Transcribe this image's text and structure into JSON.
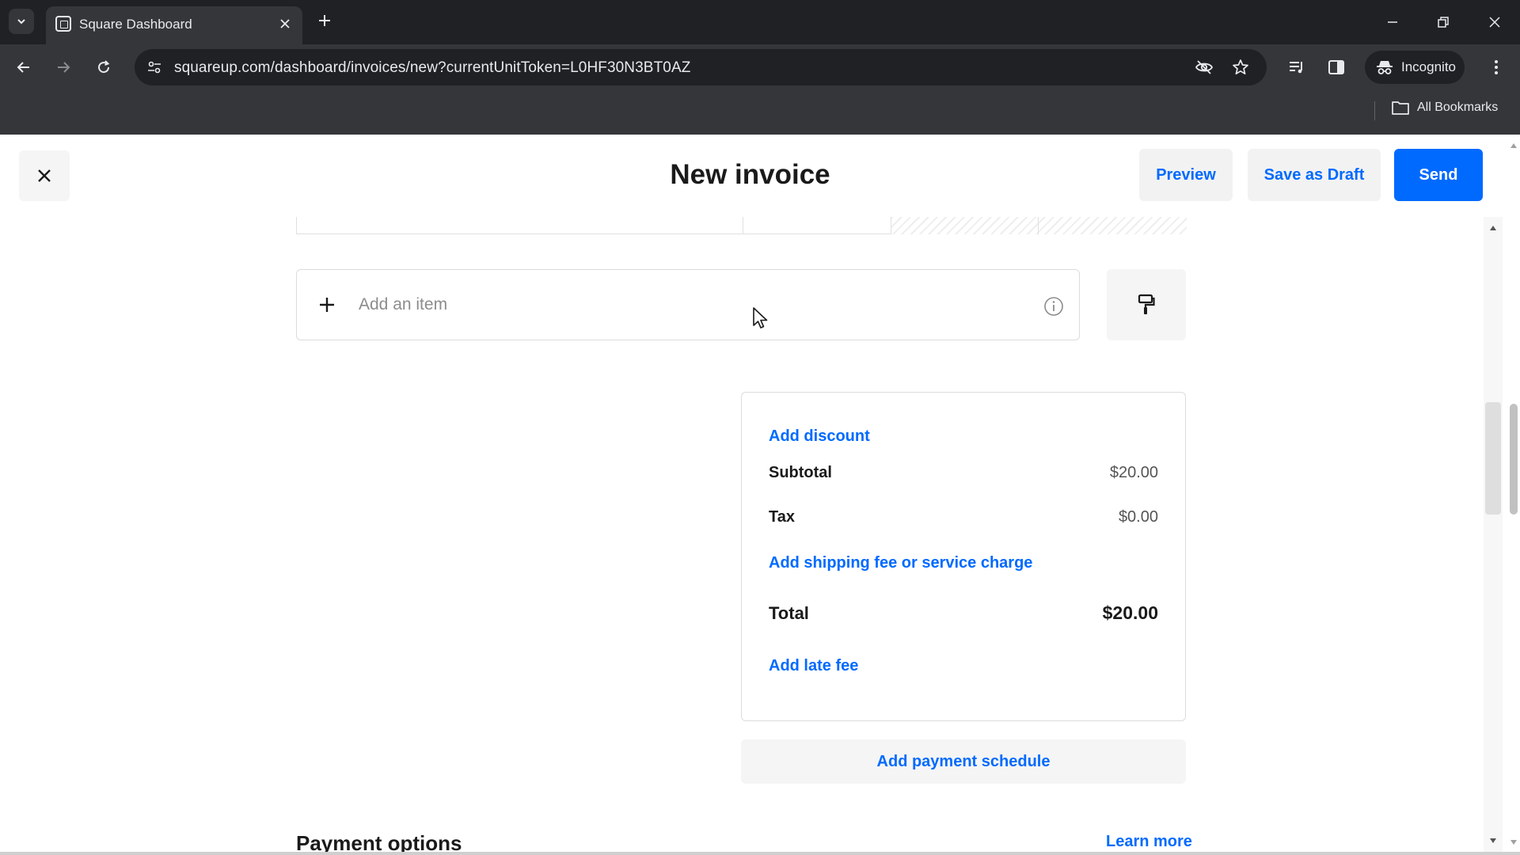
{
  "browser": {
    "tab_title": "Square Dashboard",
    "url": "squareup.com/dashboard/invoices/new?currentUnitToken=L0HF30N3BT0AZ",
    "incognito_label": "Incognito",
    "bookmarks_label": "All Bookmarks"
  },
  "header": {
    "title": "New invoice",
    "preview_label": "Preview",
    "save_draft_label": "Save as Draft",
    "send_label": "Send"
  },
  "items": {
    "add_item_placeholder": "Add an item"
  },
  "summary": {
    "add_discount": "Add discount",
    "subtotal_label": "Subtotal",
    "subtotal_value": "$20.00",
    "tax_label": "Tax",
    "tax_value": "$0.00",
    "add_shipping": "Add shipping fee or service charge",
    "total_label": "Total",
    "total_value": "$20.00",
    "add_late_fee": "Add late fee"
  },
  "schedule": {
    "label": "Add payment schedule"
  },
  "payment_options": {
    "title": "Payment options",
    "learn_more": "Learn more"
  },
  "colors": {
    "accent": "#006aff",
    "chrome_dark": "#202124",
    "chrome_mid": "#35363a"
  }
}
